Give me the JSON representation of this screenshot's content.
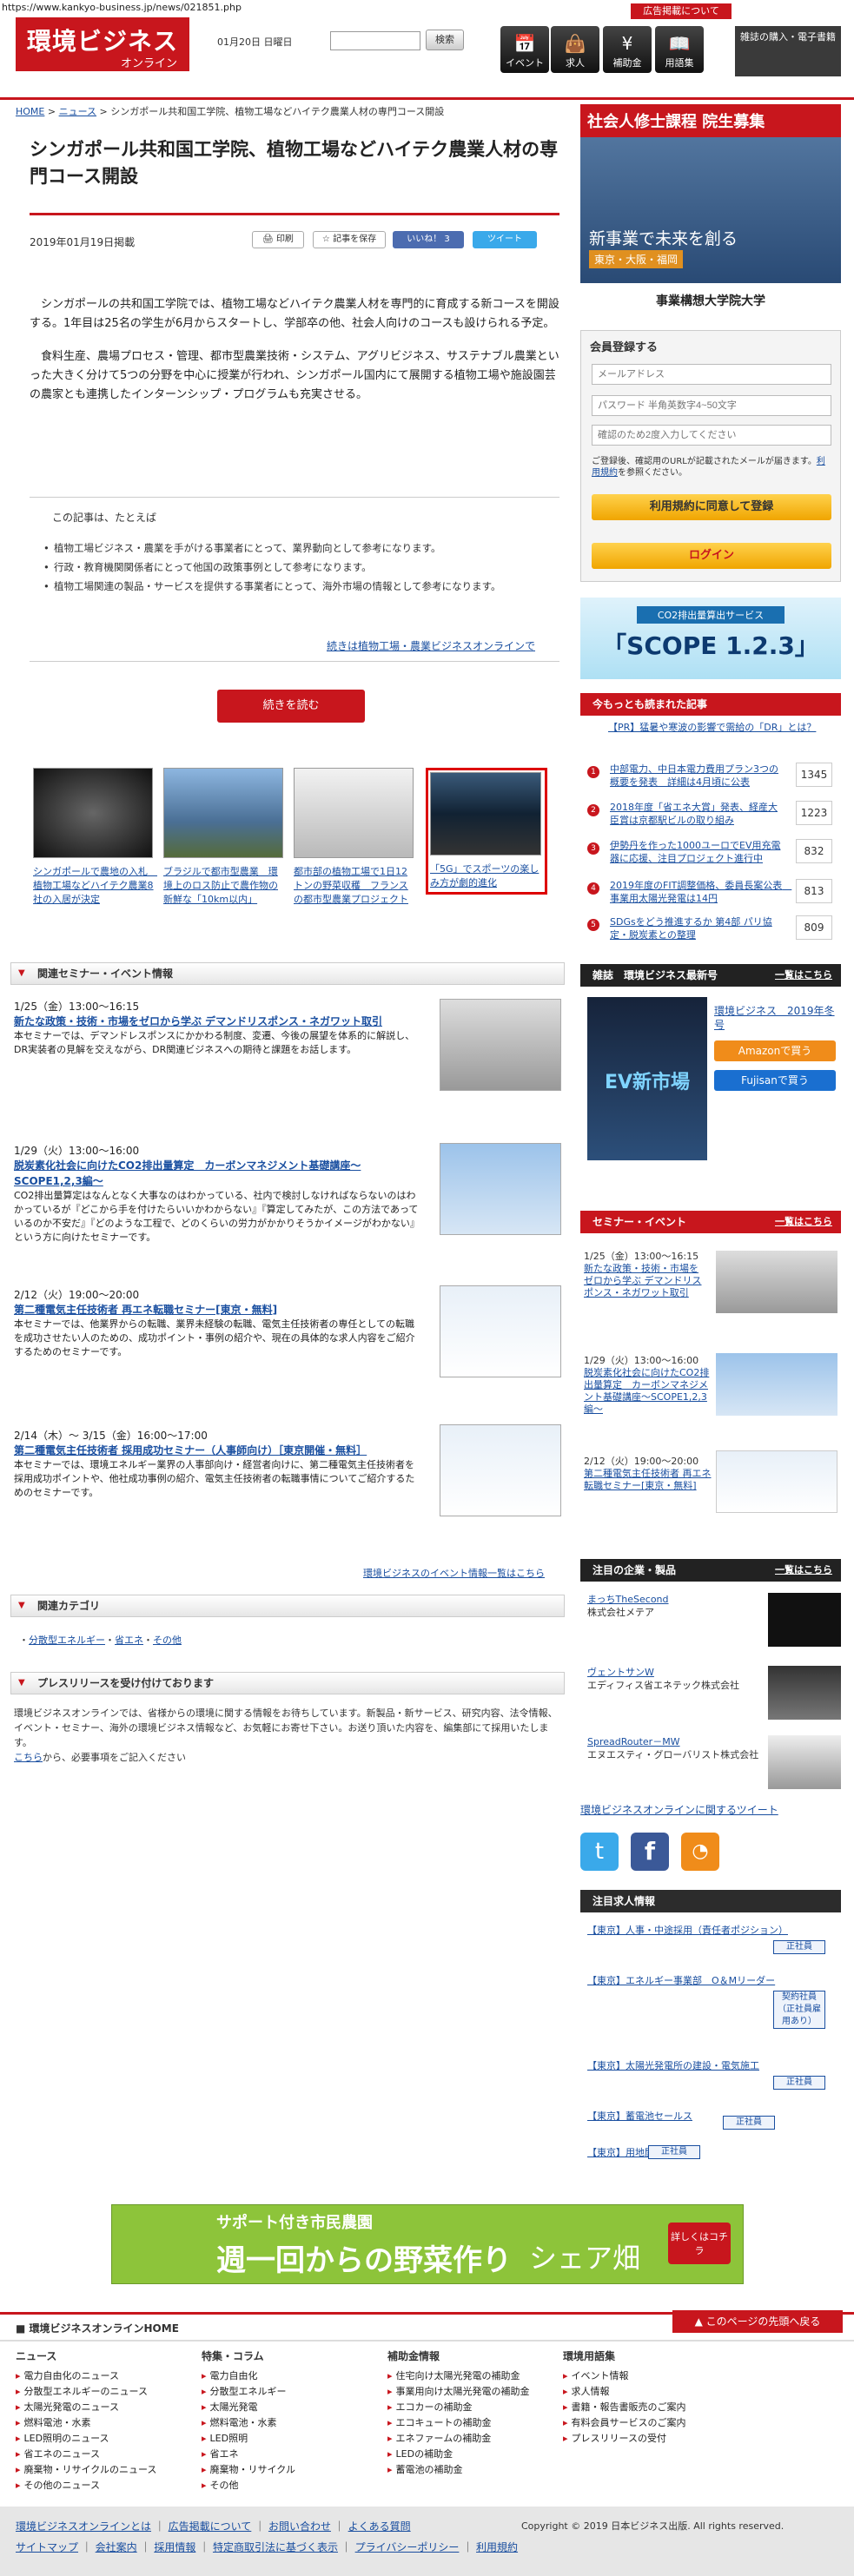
{
  "url": "https://www.kankyo-business.jp/news/021851.php",
  "header": {
    "logo": "環境ビジネス",
    "logo_sub": "オンライン",
    "date": "01月20日 日曜日",
    "search_btn": "検索",
    "ad_tag": "広告掲載について",
    "nav": [
      {
        "icon": "calendar-icon",
        "glyph": "📅",
        "label": "イベント"
      },
      {
        "icon": "briefcase-icon",
        "glyph": "👜",
        "label": "求人"
      },
      {
        "icon": "yen-icon",
        "glyph": "¥",
        "label": "補助金"
      },
      {
        "icon": "book-icon",
        "glyph": "📖",
        "label": "用語集"
      }
    ],
    "promo": "雑誌の購入・電子書籍"
  },
  "breadcrumb": {
    "home": "HOME",
    "news": "ニュース",
    "current": "シンガポール共和国工学院、植物工場などハイテク農業人材の専門コース開設"
  },
  "article": {
    "title": "シンガポール共和国工学院、植物工場などハイテク農業人材の専門コース開設",
    "date": "2019年01月19日掲載",
    "tools": {
      "print": "印刷",
      "save": "記事を保存",
      "like": "いいね！ 3",
      "tweet": "ツイート"
    },
    "p1": "シンガポールの共和国工学院では、植物工場などハイテク農業人材を専門的に育成する新コースを開設する。1年目は25名の学生が6月からスタートし、学部卒の他、社会人向けのコースも設けられる予定。",
    "p2": "食料生産、農場プロセス・管理、都市型農業技術・システム、アグリビジネス、サステナブル農業といった大きく分けて5つの分野を中心に授業が行われ、シンガポール国内にて展開する植物工場や施設園芸の農家とも連携したインターンシップ・プログラムも充実させる。",
    "box_lead": "この記事は、たとえば",
    "box_items": [
      "植物工場ビジネス・農業を手がける事業者にとって、業界動向として参考になります。",
      "行政・教育機関関係者にとって他国の政策事例として参考になります。",
      "植物工場関連の製品・サービスを提供する事業者にとって、海外市場の情報として参考になります。"
    ],
    "more_link": "続きは植物工場・農業ビジネスオンラインで",
    "read_btn": "続きを読む"
  },
  "thumbs": [
    "シンガポールで農地の入札　植物工場などハイテク農業8社の入居が決定",
    "ブラジルで都市型農業　環境上のロス防止で農作物の新鮮な「10km以内」",
    "都市部の植物工場で1日12トンの野菜収穫　フランスの都市型農業プロジェクト",
    "「5G」でスポーツの楽しみ方が劇的進化"
  ],
  "seminars": {
    "header": "関連セミナー・イベント情報",
    "items": [
      {
        "date": "1/25（金）13:00〜16:15",
        "title": "新たな政策・技術・市場をゼロから学ぶ デマンドリスポンス・ネガワット取引",
        "desc": "本セミナーでは、デマンドレスポンスにかかわる制度、変遷、今後の展望を体系的に解説し、DR実装者の見解を交えながら、DR関連ビジネスへの期待と課題をお話します。"
      },
      {
        "date": "1/29（火）13:00〜16:00",
        "title": "脱炭素化社会に向けたCO2排出量算定　カーボンマネジメント基礎講座〜SCOPE1,2,3編〜",
        "desc": "CO2排出量算定はなんとなく大事なのはわかっている、社内で検討しなければならないのはわかっているが『どこから手を付けたらいいかわからない』『算定してみたが、この方法であっているのか不安だ』『どのような工程で、どのくらいの労力がかかりそうかイメージがわかない』という方に向けたセミナーです。"
      },
      {
        "date": "2/12（火）19:00〜20:00",
        "title": "第二種電気主任技術者 再エネ転職セミナー[東京・無料]",
        "desc": "本セミナーでは、他業界からの転職、業界未経験の転職、電気主任技術者の専任としての転職を成功させたい人のための、成功ポイント・事例の紹介や、現在の具体的な求人内容をご紹介するためのセミナーです。"
      },
      {
        "date": "2/14（木）〜 3/15（金）16:00〜17:00",
        "title": "第二種電気主任技術者 採用成功セミナー（人事師向け）［東京開催・無料］",
        "desc": "本セミナーでは、環境エネルギー業界の人事部向け・経営者向けに、第二種電気主任技術者を採用成功ポイントや、他社成功事例の紹介、電気主任技術者の転職事情についてご紹介するためのセミナーです。"
      }
    ],
    "more": "環境ビジネスのイベント情報一覧はこちら"
  },
  "category": {
    "header": "関連カテゴリ",
    "items": [
      "分散型エネルギー",
      "省エネ",
      "その他"
    ]
  },
  "press": {
    "header": "プレスリリースを受け付けております",
    "text": "環境ビジネスオンラインでは、省様からの環境に関する情報をお待ちしています。新製品・新サービス、研究内容、法令情報、イベント・セミナー、海外の環境ビジネス情報など、お気軽にお寄せ下さい。お送り頂いた内容を、編集部にて採用いたします。",
    "link": "こちら",
    "link_after": "から、必要事項をご記入ください"
  },
  "sidebar": {
    "ad1": {
      "title": "社会人修士課程 院生募集",
      "sub": "新事業で未来を創る",
      "loc": "東京・大阪・福岡",
      "school": "事業構想大学院大学"
    },
    "login": {
      "header": "会員登録する",
      "email_ph": "メールアドレス",
      "pw_ph": "パスワード 半角英数字4~50文字",
      "pw2_ph": "確認のため2度入力してください",
      "note": "ご登録後、確認用のURLが記載されたメールが届きます。",
      "terms": "利用規約",
      "terms_after": "を参照ください。",
      "register": "利用規約に同意して登録",
      "login": "ログイン"
    },
    "ad2": {
      "label": "CO2排出量算出サービス",
      "title": "「SCOPE 1.2.3」"
    },
    "ranking": {
      "header": "今もっとも読まれた記事",
      "pr": "【PR】猛暑や寒波の影響で需給の「DR」とは？",
      "items": [
        {
          "n": "1",
          "t": "中部電力、中日本電力費用プラン3つの概要を発表　詳細は4月頃に公表",
          "c": "1345"
        },
        {
          "n": "2",
          "t": "2018年度「省エネ大賞」発表、経産大臣賞は京都駅ビルの取り組み",
          "c": "1223"
        },
        {
          "n": "3",
          "t": "伊勢丹を作った1000ユーロでEV用充電器に応援、注目プロジェクト進行中",
          "c": "832"
        },
        {
          "n": "4",
          "t": "2019年度のFIT調整価格、委員長案公表　事業用太陽光発電は14円",
          "c": "813"
        },
        {
          "n": "5",
          "t": "SDGsをどう推進するか 第4部 パリ協定・脱炭素との整理",
          "c": "809"
        }
      ]
    },
    "magazine": {
      "header": "雑誌　環境ビジネス最新号",
      "more": "一覧はこちら",
      "issue": "環境ビジネス　2019年冬号",
      "cover": "EV新市場",
      "amazon": "Amazonで買う",
      "fujisan": "Fujisanで買う"
    },
    "events": {
      "header": "セミナー・イベント",
      "more": "一覧はこちら",
      "items": [
        {
          "d": "1/25（金）13:00〜16:15",
          "t": "新たな政策・技術・市場をゼロから学ぶ デマンドリスポンス・ネガワット取引"
        },
        {
          "d": "1/29（火）13:00〜16:00",
          "t": "脱炭素化社会に向けたCO2排出量算定　カーボンマネジメント基礎講座〜SCOPE1,2,3編〜"
        },
        {
          "d": "2/12（火）19:00〜20:00",
          "t": "第二種電気主任技術者 再エネ転職セミナー[東京・無料]"
        }
      ]
    },
    "products": {
      "header": "注目の企業・製品",
      "more": "一覧はこちら",
      "items": [
        {
          "n": "まっちTheSecond",
          "c": "株式会社メテア"
        },
        {
          "n": "ヴェントサンW",
          "c": "エディフィス省エネテック株式会社"
        },
        {
          "n": "SpreadRouter－MW",
          "c": "エヌエスティ・グローバリスト株式会社"
        }
      ]
    },
    "tweet_link": "環境ビジネスオンラインに関するツイート",
    "jobs": {
      "header": "注目求人情報",
      "items": [
        {
          "t": "【東京】人事・中途採用（責任者ポジション）",
          "b": "正社員"
        },
        {
          "t": "【東京】エネルギー事業部　O＆Mリーダー",
          "b": "契約社員（正社員雇用あり）"
        },
        {
          "t": "【東京】太陽光発電所の建設・電気施工",
          "b": "正社員"
        },
        {
          "t": "【東京】蓄電池セールス",
          "b": "正社員"
        },
        {
          "t": "【東京】用地開発",
          "b": "正社員"
        }
      ]
    }
  },
  "banner": {
    "top": "サポート付き市民農園",
    "main": "週一回からの野菜作り",
    "brand": "シェア畑",
    "cta": "詳しくはコチラ"
  },
  "footer": {
    "home": "環境ビジネスオンラインHOME",
    "top": "このページの先頭へ戻る",
    "cols": [
      {
        "h": "ニュース",
        "i": [
          "電力自由化のニュース",
          "分散型エネルギーのニュース",
          "太陽光発電のニュース",
          "燃料電池・水素",
          "LED照明のニュース",
          "省エネのニュース",
          "廃棄物・リサイクルのニュース",
          "その他のニュース"
        ]
      },
      {
        "h": "特集・コラム",
        "i": [
          "電力自由化",
          "分散型エネルギー",
          "太陽光発電",
          "燃料電池・水素",
          "LED照明",
          "省エネ",
          "廃棄物・リサイクル",
          "その他"
        ]
      },
      {
        "h": "補助金情報",
        "i": [
          "住宅向け太陽光発電の補助金",
          "事業用向け太陽光発電の補助金",
          "エコカーの補助金",
          "エコキュートの補助金",
          "エネファームの補助金",
          "LEDの補助金",
          "蓄電池の補助金"
        ]
      },
      {
        "h": "環境用語集",
        "i": [
          "イベント情報",
          "求人情報",
          "書籍・報告書販売のご案内",
          "有料会員サービスのご案内",
          "プレスリリースの受付"
        ]
      }
    ],
    "links1": [
      "環境ビジネスオンラインとは",
      "広告掲載について",
      "お問い合わせ",
      "よくある質問"
    ],
    "links2": [
      "サイトマップ",
      "会社案内",
      "採用情報",
      "特定商取引法に基づく表示",
      "プライバシーポリシー",
      "利用規約"
    ],
    "copy": "Copyright © 2019 日本ビジネス出版. All rights reserved."
  }
}
